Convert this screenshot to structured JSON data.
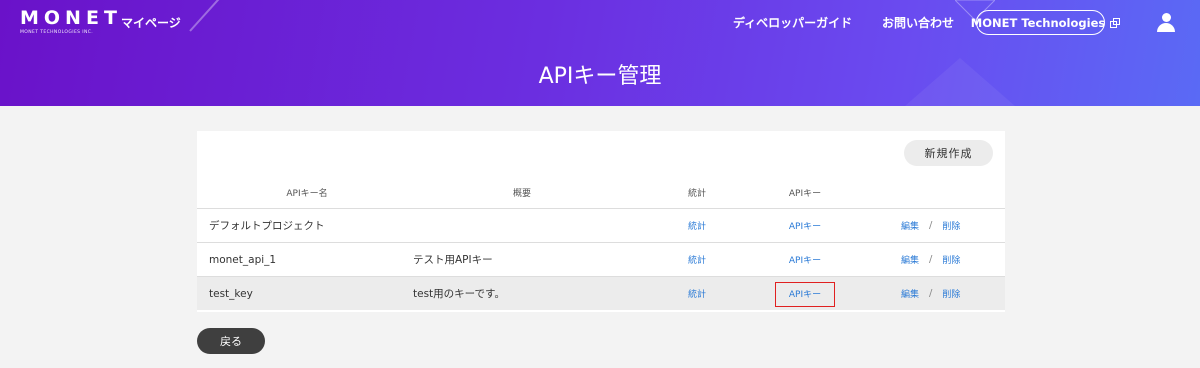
{
  "header": {
    "logo_main": "MONET",
    "logo_sub": "MONET TECHNOLOGIES INC.",
    "mypage": "マイページ",
    "developer_guide": "ディベロッパーガイド",
    "contact": "お問い合わせ",
    "company_button": "MONET Technologies",
    "title": "APIキー管理",
    "gradient_colors": [
      "#6a12c9",
      "#6b2ee0",
      "#6a4bf0",
      "#5a6af5"
    ]
  },
  "toolbar": {
    "new_button": "新規作成"
  },
  "table": {
    "headers": [
      "APIキー名",
      "概要",
      "統計",
      "APIキー"
    ],
    "rows": [
      {
        "name": "デフォルトプロジェクト",
        "summary": "",
        "stats": "統計",
        "apikey": "APIキー",
        "edit": "編集",
        "delete": "削除",
        "separator": "/"
      },
      {
        "name": "monet_api_1",
        "summary": "テスト用APIキー",
        "stats": "統計",
        "apikey": "APIキー",
        "edit": "編集",
        "delete": "削除",
        "separator": "/"
      },
      {
        "name": "test_key",
        "summary": "test用のキーです。",
        "stats": "統計",
        "apikey": "APIキー",
        "edit": "編集",
        "delete": "削除",
        "separator": "/"
      }
    ]
  },
  "footer": {
    "back_button": "戻る"
  },
  "colors": {
    "link": "#2a7ad6",
    "highlight": "#e02020",
    "back_button": "#3f3f3f"
  }
}
